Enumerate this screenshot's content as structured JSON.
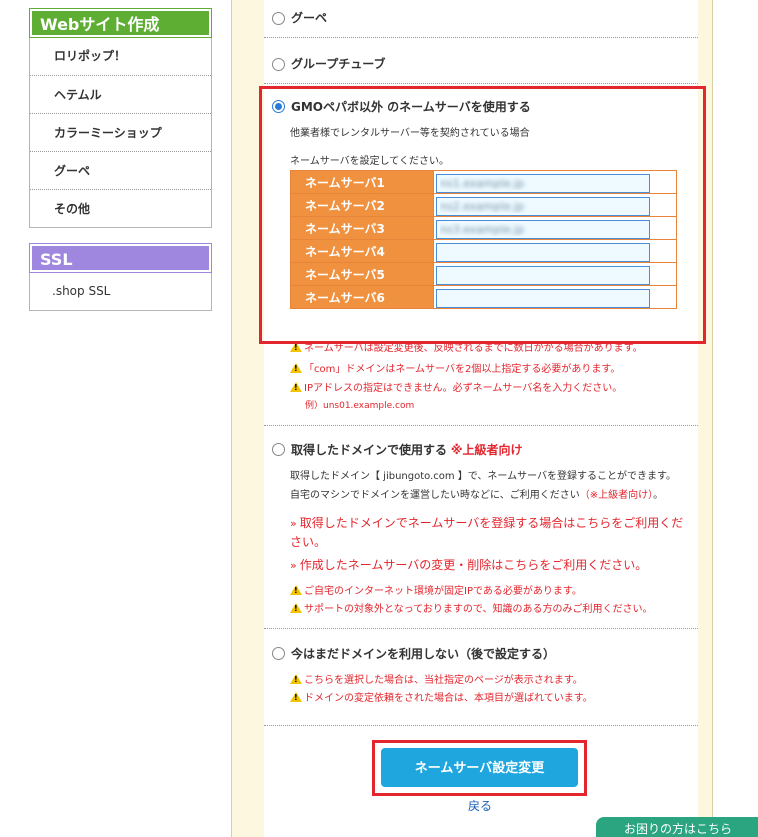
{
  "sidebar": {
    "website": {
      "title": "Webサイト作成",
      "items": [
        "ロリポップ！",
        "ヘテムル",
        "カラーミーショップ",
        "グーペ",
        "その他"
      ]
    },
    "ssl": {
      "title": "SSL",
      "items": [
        ".shop SSL"
      ]
    }
  },
  "options": {
    "goope": "グーペ",
    "grouptube": "グループチューブ",
    "other_ns": {
      "title": "GMOペパボ以外 のネームサーバを使用する",
      "desc": "他業者様でレンタルサーバー等を契約されている場合",
      "instruction": "ネームサーバを設定してください。",
      "nameservers": [
        {
          "label": "ネームサーバ1",
          "value": "ns1.example.jp"
        },
        {
          "label": "ネームサーバ2",
          "value": "ns2.example.jp"
        },
        {
          "label": "ネームサーバ3",
          "value": "ns3.example.jp"
        },
        {
          "label": "ネームサーバ4",
          "value": ""
        },
        {
          "label": "ネームサーバ5",
          "value": ""
        },
        {
          "label": "ネームサーバ6",
          "value": ""
        }
      ],
      "warnings": [
        "ネームサーバは設定変更後、反映されるまでに数日かかる場合があります。",
        "「com」ドメインはネームサーバを2個以上指定する必要があります。",
        "IPアドレスの指定はできません。必ずネームサーバ名を入力ください。"
      ],
      "example": "例）uns01.example.com"
    },
    "own_domain": {
      "title": "取得したドメインで使用する",
      "tag": "※上級者向け",
      "desc1": "取得したドメイン【 jibungoto.com 】で、ネームサーバを登録することができます。",
      "desc2": "自宅のマシンでドメインを運営したい時などに、ご利用ください",
      "desc2_tag": "（※上級者向け）",
      "desc2_end": "。",
      "link1": "取得したドメインでネームサーバを登録する場合はこちらをご利用ください。",
      "link2": "作成したネームサーバの変更・削除はこちらをご利用ください。",
      "warnings": [
        "ご自宅のインターネット環境が固定IPである必要があります。",
        "サポートの対象外となっておりますので、知識のある方のみご利用ください。"
      ]
    },
    "later": {
      "title": "今はまだドメインを利用しない（後で設定する）",
      "warnings": [
        "こちらを選択した場合は、当社指定のページが表示されます。",
        "ドメインの変定依頼をされた場合は、本項目が選ばれています。"
      ]
    }
  },
  "submit_label": "ネームサーバ設定変更",
  "back_label": "戻る",
  "help_label": "お困りの方はこちら"
}
